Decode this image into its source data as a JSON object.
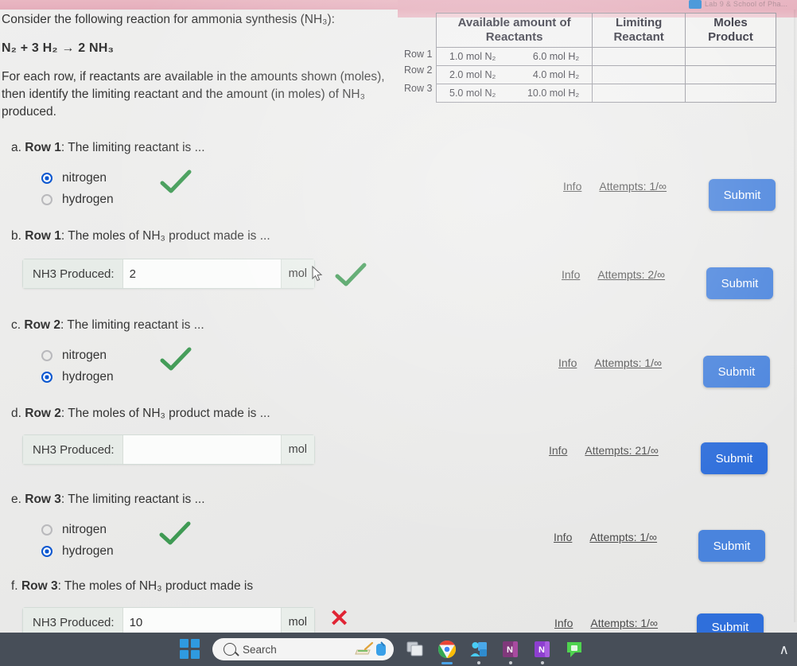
{
  "window": {
    "ghost_tab_text": "Lab 9 & School of Pha...",
    "taskbar": {
      "search_placeholder": "Search",
      "icons": [
        {
          "name": "task-view-icon",
          "label": "Task View"
        },
        {
          "name": "chrome-icon",
          "label": "Google Chrome"
        },
        {
          "name": "teams-icon",
          "label": "Microsoft Teams"
        },
        {
          "name": "onenote-icon",
          "label": "OneNote"
        },
        {
          "name": "onenote-2-icon",
          "label": "OneNote"
        },
        {
          "name": "whatsapp-icon",
          "label": "WhatsApp"
        }
      ],
      "chevron": "∧"
    }
  },
  "prompt": {
    "line1": "Consider the following reaction for ammonia synthesis (NH₃):",
    "equation": "N₂ + 3 H₂ → 2 NH₃",
    "line3": "For each row, if reactants are available in the amounts shown (moles), then identify the limiting reactant and the amount (in moles) of NH₃ produced."
  },
  "table": {
    "headers": [
      "Available amount of Reactants",
      "Limiting Reactant",
      "Moles Product"
    ],
    "rows": [
      {
        "label": "Row 1",
        "reactant_n2": "1.0 mol N₂",
        "reactant_h2": "6.0 mol H₂",
        "limiting": "",
        "moles_product": ""
      },
      {
        "label": "Row 2",
        "reactant_n2": "2.0 mol N₂",
        "reactant_h2": "4.0 mol H₂",
        "limiting": "",
        "moles_product": ""
      },
      {
        "label": "Row 3",
        "reactant_n2": "5.0 mol N₂",
        "reactant_h2": "10.0 mol H₂",
        "limiting": "",
        "moles_product": ""
      }
    ]
  },
  "questions": [
    {
      "key": "a",
      "letter": "a.",
      "row": "Row 1",
      "text": ": The limiting reactant is ...",
      "type": "radio",
      "options": [
        {
          "label": "nitrogen",
          "selected": true
        },
        {
          "label": "hydrogen",
          "selected": false
        }
      ],
      "feedback": "correct",
      "info_label": "Info",
      "attempts_label": "Attempts: 1/∞",
      "submit_label": "Submit"
    },
    {
      "key": "b",
      "letter": "b.",
      "row": "Row 1",
      "text": ": The moles of NH₃ product made is ...",
      "type": "input",
      "field_label": "NH3 Produced:",
      "value": "2",
      "unit": "mol",
      "feedback": "correct",
      "info_label": "Info",
      "attempts_label": "Attempts: 2/∞",
      "submit_label": "Submit"
    },
    {
      "key": "c",
      "letter": "c.",
      "row": "Row 2",
      "text": ": The limiting reactant is ...",
      "type": "radio",
      "options": [
        {
          "label": "nitrogen",
          "selected": false
        },
        {
          "label": "hydrogen",
          "selected": true
        }
      ],
      "feedback": "correct",
      "info_label": "Info",
      "attempts_label": "Attempts: 1/∞",
      "submit_label": "Submit"
    },
    {
      "key": "d",
      "letter": "d.",
      "row": "Row 2",
      "text": ": The moles of NH₃ product made is ...",
      "type": "input",
      "field_label": "NH3 Produced:",
      "value": "",
      "unit": "mol",
      "feedback": "none",
      "info_label": "Info",
      "attempts_label": "Attempts: 21/∞",
      "submit_label": "Submit"
    },
    {
      "key": "e",
      "letter": "e.",
      "row": "Row 3",
      "text": ": The limiting reactant is ...",
      "type": "radio",
      "options": [
        {
          "label": "nitrogen",
          "selected": false
        },
        {
          "label": "hydrogen",
          "selected": true
        }
      ],
      "feedback": "correct",
      "info_label": "Info",
      "attempts_label": "Attempts: 1/∞",
      "submit_label": "Submit"
    },
    {
      "key": "f",
      "letter": "f.",
      "row": "Row 3",
      "text": ": The moles of NH₃ product made is",
      "type": "input",
      "field_label": "NH3 Produced:",
      "value": "10",
      "unit": "mol",
      "feedback": "incorrect",
      "info_label": "Info",
      "attempts_label": "Attempts: 1/∞",
      "submit_label": "Submit"
    }
  ],
  "colors": {
    "submit_blue": "#4a84dd",
    "radio_blue": "#0b57d0",
    "check_green": "#3f9a54",
    "cross_red": "#e02434",
    "banner_pink": "#e7b2bf"
  }
}
